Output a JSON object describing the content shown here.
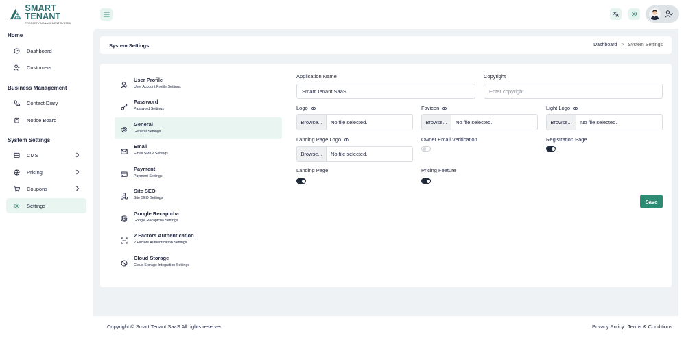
{
  "brand": {
    "title": "SMART TENANT",
    "subtitle": "PROPERTY MANAGEMENT SYSTEM",
    "color": "#2d6b6b"
  },
  "sidebar": {
    "sections": [
      {
        "title": "Home",
        "items": [
          {
            "label": "Dashboard",
            "icon": "gauge-icon"
          },
          {
            "label": "Customers",
            "icon": "user-plus-icon"
          }
        ]
      },
      {
        "title": "Business Management",
        "items": [
          {
            "label": "Contact Diary",
            "icon": "phone-icon"
          },
          {
            "label": "Notice Board",
            "icon": "clipboard-icon"
          }
        ]
      },
      {
        "title": "System Settings",
        "items": [
          {
            "label": "CMS",
            "icon": "layout-icon",
            "chevron": true
          },
          {
            "label": "Pricing",
            "icon": "tag-icon",
            "chevron": true
          },
          {
            "label": "Coupons",
            "icon": "cart-icon",
            "chevron": true
          },
          {
            "label": "Settings",
            "icon": "gear-icon",
            "active": true
          }
        ]
      }
    ]
  },
  "breadcrumb": {
    "title": "System Settings",
    "trail": [
      "Dashboard",
      "System Settings"
    ]
  },
  "settings_menu": [
    {
      "title": "User Profile",
      "subtitle": "User Account Profile Settings",
      "icon": "user-icon"
    },
    {
      "title": "Password",
      "subtitle": "Password Settings",
      "icon": "key-icon"
    },
    {
      "title": "General",
      "subtitle": "General Settings",
      "icon": "gear-icon",
      "active": true
    },
    {
      "title": "Email",
      "subtitle": "Email SMTP Settings",
      "icon": "mail-icon"
    },
    {
      "title": "Payment",
      "subtitle": "Payment Settings",
      "icon": "credit-card-icon"
    },
    {
      "title": "Site SEO",
      "subtitle": "Site SEO Settings",
      "icon": "network-icon"
    },
    {
      "title": "Google Recaptcha",
      "subtitle": "Google Recaptcha Settings",
      "icon": "google-icon"
    },
    {
      "title": "2 Factors Authentication",
      "subtitle": "2 Factors Authentication Settings",
      "icon": "scan-icon"
    },
    {
      "title": "Cloud Storage",
      "subtitle": "Cloud Storage Integration Settings",
      "icon": "cloud-icon"
    }
  ],
  "form": {
    "app_name": {
      "label": "Application Name",
      "value": "Smart Tenant SaaS"
    },
    "copyright": {
      "label": "Copyright",
      "placeholder": "Enter copyright"
    },
    "logo": {
      "label": "Logo",
      "browse": "Browse...",
      "file": "No file selected."
    },
    "favicon": {
      "label": "Favicon",
      "browse": "Browse...",
      "file": "No file selected."
    },
    "light_logo": {
      "label": "Light Logo",
      "browse": "Browse...",
      "file": "No file selected."
    },
    "landing_logo": {
      "label": "Landing Page Logo",
      "browse": "Browse...",
      "file": "No file selected."
    },
    "owner_email": {
      "label": "Owner Email Verification",
      "enabled": false
    },
    "registration": {
      "label": "Registration Page",
      "enabled": true
    },
    "landing_page": {
      "label": "Landing Page",
      "enabled": true
    },
    "pricing_feature": {
      "label": "Pricing Feature",
      "enabled": true
    },
    "save_label": "Save"
  },
  "footer": {
    "copyright": "Copyright © Smart Tenant SaaS All rights reserved.",
    "privacy": "Privacy Policy",
    "terms": "Terms & Conditions"
  },
  "colors": {
    "accent": "#2e8b74",
    "active_bg": "#e8f5f1",
    "toggle_on": "#1e2a3a"
  }
}
